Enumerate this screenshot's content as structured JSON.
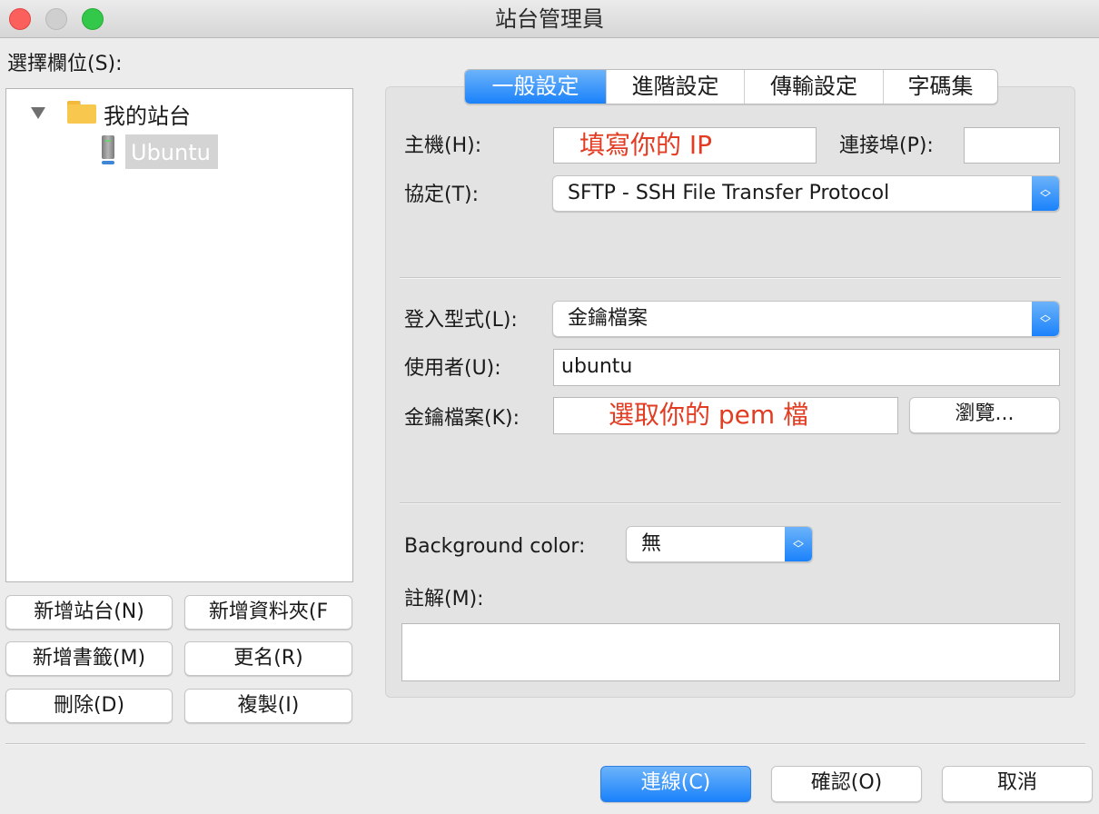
{
  "window": {
    "title": "站台管理員"
  },
  "left": {
    "select_label": "選擇欄位(S):",
    "tree": {
      "folder": "我的站台",
      "site": "Ubuntu"
    },
    "buttons": {
      "new_site": "新增站台(N)",
      "new_folder": "新增資料夾(F",
      "new_bookmark": "新增書籤(M)",
      "rename": "更名(R)",
      "delete": "刪除(D)",
      "duplicate": "複製(I)"
    }
  },
  "tabs": [
    "一般設定",
    "進階設定",
    "傳輸設定",
    "字碼集"
  ],
  "active_tab": "一般設定",
  "general": {
    "host_label": "主機(H):",
    "host_value": "填寫你的 IP",
    "port_label": "連接埠(P):",
    "port_value": "",
    "protocol_label": "協定(T):",
    "protocol_value": "SFTP - SSH File Transfer Protocol",
    "logon_type_label": "登入型式(L):",
    "logon_type_value": "金鑰檔案",
    "user_label": "使用者(U):",
    "user_value": "ubuntu",
    "keyfile_label": "金鑰檔案(K):",
    "keyfile_value": "選取你的 pem 檔",
    "browse_label": "瀏覽...",
    "bg_color_label": "Background color:",
    "bg_color_value": "無",
    "comments_label": "註解(M):",
    "comments_value": ""
  },
  "footer": {
    "connect": "連線(C)",
    "ok": "確認(O)",
    "cancel": "取消"
  },
  "colors": {
    "accent": "#1a82fb",
    "annotation_red": "#e23c22"
  }
}
